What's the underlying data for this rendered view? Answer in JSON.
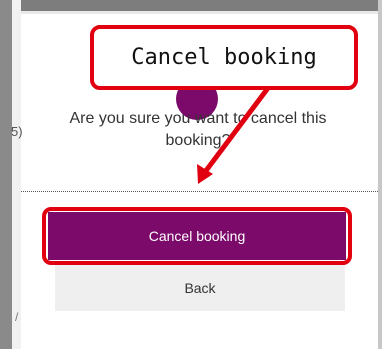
{
  "dialog": {
    "question": "Are you sure you want to cancel this booking?",
    "primary_button_label": "Cancel booking",
    "secondary_button_label": "Back",
    "edge_glyph_1": "5)",
    "edge_glyph_2": "/"
  },
  "annotation": {
    "callout_text": "Cancel booking"
  },
  "colors": {
    "brand": "#7b0a6a",
    "annotation_red": "#e1000f",
    "secondary_bg": "#efefef"
  },
  "icons": {
    "avatar": "avatar-circle",
    "arrow": "annotation-arrow"
  }
}
